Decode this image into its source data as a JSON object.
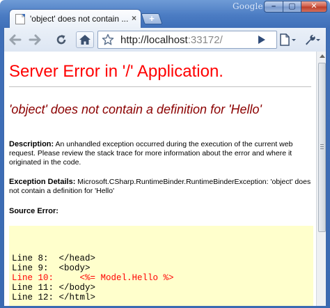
{
  "titlebar": {
    "brand": "Google",
    "minimize": "–",
    "maximize": "▢",
    "close": "✕"
  },
  "tab": {
    "title": "'object' does not contain ...",
    "close": "×",
    "new_tab": "+"
  },
  "toolbar": {
    "url_host": "http://localhost",
    "url_rest": ":33172/"
  },
  "page": {
    "title": "Server Error in '/' Application.",
    "error_title": "'object' does not contain a definition for 'Hello'",
    "description_label": "Description:",
    "description_text": " An unhandled exception occurred during the execution of the current web request. Please review the stack trace for more information about the error and where it originated in the code.",
    "exception_label": "Exception Details:",
    "exception_text": " Microsoft.CSharp.RuntimeBinder.RuntimeBinderException: 'object' does not contain a definition for 'Hello'",
    "source_label": "Source Error:",
    "source_lines": [
      "Line 8:  </head>",
      "Line 9:  <body>",
      "Line 10:     <%= Model.Hello %>",
      "Line 11: </body>",
      "Line 12: </html>"
    ]
  },
  "colors": {
    "title_red": "#ff0000",
    "error_dark_red": "#8b0000",
    "code_background": "#ffffcc",
    "chrome_frame_blue": "#3f6fb8"
  }
}
